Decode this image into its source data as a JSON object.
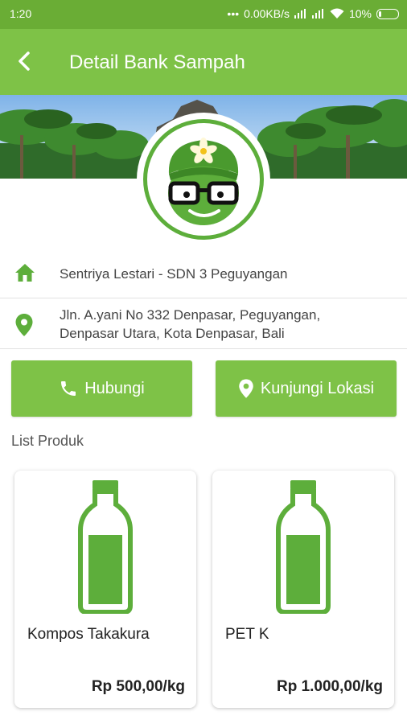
{
  "status": {
    "time": "1:20",
    "speed": "0.00KB/s",
    "battery": "10%"
  },
  "appbar": {
    "title": "Detail Bank Sampah"
  },
  "info": {
    "name": "Sentriya Lestari - SDN 3 Peguyangan",
    "address_line1": "Jln. A.yani No 332 Denpasar, Peguyangan,",
    "address_line2": "Denpasar Utara, Kota Denpasar, Bali"
  },
  "actions": {
    "call_label": "Hubungi",
    "visit_label": "Kunjungi Lokasi"
  },
  "products": {
    "section_title": "List Produk",
    "items": [
      {
        "name": "Kompos Takakura",
        "price": "Rp 500,00/kg"
      },
      {
        "name": "PET K",
        "price": "Rp 1.000,00/kg"
      }
    ]
  },
  "colors": {
    "status_bar": "#6aad35",
    "app_bar": "#7ec247",
    "accent": "#5dae3b",
    "button": "#7ec247"
  }
}
